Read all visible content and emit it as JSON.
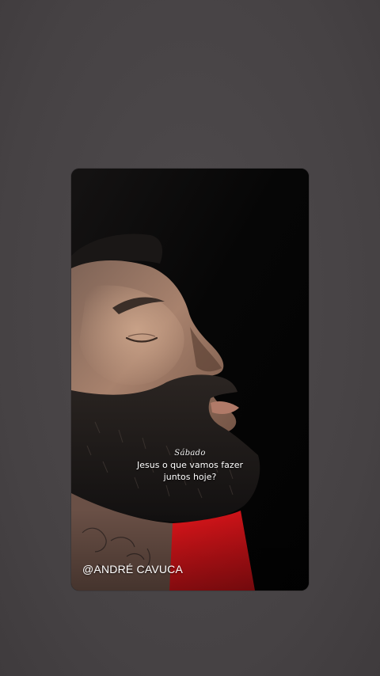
{
  "story": {
    "day_label": "Sábado",
    "caption": "Jesus o que vamos fazer juntos hoje?",
    "watermark": "@ANDRÉ CAVUCA"
  },
  "colors": {
    "page_background": "#4b4749",
    "card_background": "#050505",
    "text": "#ffffff",
    "shirt": "#d8141a"
  },
  "photo": {
    "subject": "portrait-man-eyes-closed"
  }
}
